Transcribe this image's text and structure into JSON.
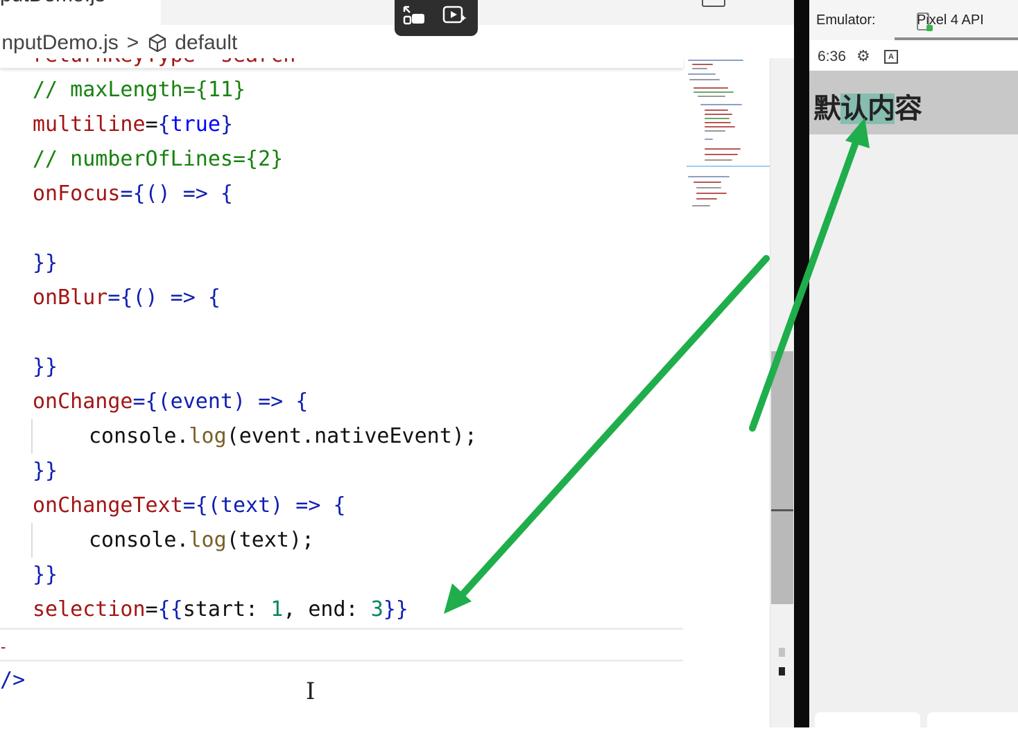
{
  "tab": {
    "filename": "putDemo.js",
    "close": "×"
  },
  "breadcrumb": {
    "file": "InputDemo.js",
    "separator": ">",
    "symbol": "default"
  },
  "editor": {
    "sticky": "returnKeyType=\"search\"",
    "lines": {
      "l1": "// maxLength={11}",
      "l2_attr": "multiline",
      "l2_eq": "=",
      "l2_open": "{",
      "l2_val": "true",
      "l2_close": "}",
      "l3": "// numberOfLines={2}",
      "l4_attr": "onFocus",
      "l4_rest": "={() => {",
      "l6": "}}",
      "l7_attr": "onBlur",
      "l7_rest": "={() => {",
      "l9": "}}",
      "l10_attr": "onChange",
      "l10_rest": "={(event) => {",
      "l11_obj": "console.",
      "l11_fn": "log",
      "l11_args": "(event.nativeEvent);",
      "l12": "}}",
      "l13_attr": "onChangeText",
      "l13_rest": "={(text) => {",
      "l14_obj": "console.",
      "l14_fn": "log",
      "l14_args": "(text);",
      "l15": "}}",
      "l16_attr": "selection",
      "l16_eq": "=",
      "l16_open": "{{",
      "l16_start": "start:",
      "l16_n1": "1",
      "l16_comma": ",",
      "l16_end": "end:",
      "l16_n2": "3",
      "l16_close": "}}"
    },
    "fragment_tag_end": "/>",
    "fragment_red": "-"
  },
  "emulator": {
    "label": "Emulator:",
    "device": "Pixel 4 API",
    "status_time": "6:36",
    "status_a": "A",
    "input_text_before": "默",
    "input_text_selected": "认内",
    "input_text_after": "容"
  },
  "selection": {
    "start": 1,
    "end": 3
  },
  "colors": {
    "arrow": "#1fae4b",
    "selection_highlight": "#86bdb0",
    "attr": "#a31515",
    "comment": "#17820f",
    "brace": "#0f1fb0"
  }
}
